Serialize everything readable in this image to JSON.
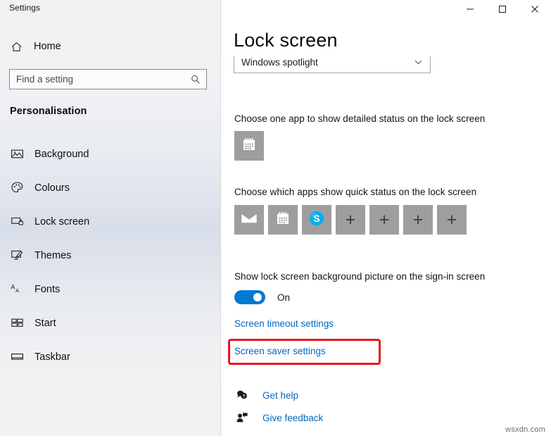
{
  "window": {
    "app_title": "Settings",
    "controls": [
      {
        "name": "minimize",
        "glyph": "minimize-icon"
      },
      {
        "name": "maximize",
        "glyph": "maximize-icon"
      },
      {
        "name": "close",
        "glyph": "close-icon"
      }
    ]
  },
  "sidebar": {
    "home_label": "Home",
    "home_icon": "home-icon",
    "search": {
      "placeholder": "Find a setting",
      "value": "",
      "icon": "search-icon"
    },
    "section_title": "Personalisation",
    "items": [
      {
        "label": "Background",
        "icon": "image-icon",
        "selected": false
      },
      {
        "label": "Colours",
        "icon": "palette-icon",
        "selected": false
      },
      {
        "label": "Lock screen",
        "icon": "lock-screen-icon",
        "selected": true
      },
      {
        "label": "Themes",
        "icon": "themes-brush-icon",
        "selected": false
      },
      {
        "label": "Fonts",
        "icon": "fonts-aa-icon",
        "selected": false
      },
      {
        "label": "Start",
        "icon": "start-tiles-icon",
        "selected": false
      },
      {
        "label": "Taskbar",
        "icon": "taskbar-icon",
        "selected": false
      }
    ]
  },
  "main": {
    "page_title": "Lock screen",
    "background_dropdown": {
      "value": "Windows spotlight",
      "chevron": "chevron-down-icon"
    },
    "detailed_status": {
      "label": "Choose one app to show detailed status on the lock screen",
      "app": {
        "name": "calendar-app",
        "icon": "calendar-icon"
      }
    },
    "quick_status": {
      "label": "Choose which apps show quick status on the lock screen",
      "apps": [
        {
          "name": "mail-app",
          "icon": "mail-icon",
          "type": "app"
        },
        {
          "name": "calendar-app",
          "icon": "calendar-icon",
          "type": "app"
        },
        {
          "name": "skype-app",
          "icon": "skype-icon",
          "type": "app"
        },
        {
          "name": "add-slot-1",
          "icon": "plus-icon",
          "type": "empty",
          "glyph": "+"
        },
        {
          "name": "add-slot-2",
          "icon": "plus-icon",
          "type": "empty",
          "glyph": "+"
        },
        {
          "name": "add-slot-3",
          "icon": "plus-icon",
          "type": "empty",
          "glyph": "+"
        },
        {
          "name": "add-slot-4",
          "icon": "plus-icon",
          "type": "empty",
          "glyph": "+"
        }
      ]
    },
    "show_background_on_signin": {
      "label": "Show lock screen background picture on the sign-in screen",
      "state": "On"
    },
    "links": {
      "screen_timeout": "Screen timeout settings",
      "screen_saver": "Screen saver settings"
    },
    "help": [
      {
        "label": "Get help",
        "icon": "question-bubble-icon"
      },
      {
        "label": "Give feedback",
        "icon": "person-feedback-icon"
      }
    ]
  },
  "annotation": {
    "highlight_color": "#e8161c",
    "target": "Screen saver settings"
  },
  "watermark": "wsxdn.com",
  "colors": {
    "accent_blue": "#0078d4",
    "link_blue": "#0067c0",
    "tile_gray": "#9e9e9e",
    "skype_blue": "#00aff0"
  }
}
